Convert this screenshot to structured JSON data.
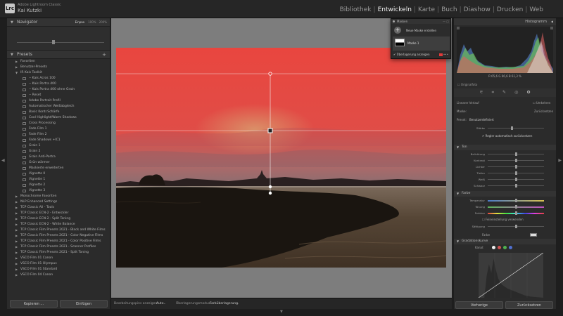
{
  "app": {
    "logo": "Lrc",
    "title": "Adobe Lightroom Classic",
    "user": "Kai Kutzki"
  },
  "modules": [
    "Bibliothek",
    "Entwickeln",
    "Karte",
    "Buch",
    "Diashow",
    "Drucken",
    "Web"
  ],
  "active_module": "Entwickeln",
  "navigator": {
    "title": "Navigator",
    "options": [
      "Einpas.",
      "100%",
      "200%"
    ],
    "active_option": "Einpas."
  },
  "presets": {
    "title": "Presets",
    "add_label": "+",
    "items": [
      {
        "label": "Favoriten",
        "level": 0,
        "kind": "group"
      },
      {
        "label": "Benutzer-Presets",
        "level": 0,
        "kind": "group"
      },
      {
        "label": "IR Kais Toolkit",
        "level": 0,
        "kind": "open"
      },
      {
        "label": "-- Kais Acros 100",
        "level": 1,
        "kind": "preset"
      },
      {
        "label": "-- Kais Portra 400",
        "level": 1,
        "kind": "preset"
      },
      {
        "label": "-- Kais Portra 400 ohne Grain",
        "level": 1,
        "kind": "preset"
      },
      {
        "label": "-- Reset",
        "level": 1,
        "kind": "preset"
      },
      {
        "label": "Adobe Portrait Profil",
        "level": 1,
        "kind": "preset"
      },
      {
        "label": "Automatischer Weißabgleich",
        "level": 1,
        "kind": "preset"
      },
      {
        "label": "Basic Kontr.Schärfe",
        "level": 1,
        "kind": "preset"
      },
      {
        "label": "Cool Highlight/Warm Shadows",
        "level": 1,
        "kind": "preset"
      },
      {
        "label": "Cross Processing",
        "level": 1,
        "kind": "preset"
      },
      {
        "label": "Fade Film 1",
        "level": 1,
        "kind": "preset"
      },
      {
        "label": "Fade Film 2",
        "level": 1,
        "kind": "preset"
      },
      {
        "label": "Fade Shadows +IC1",
        "level": 1,
        "kind": "preset"
      },
      {
        "label": "Grain 1",
        "level": 1,
        "kind": "preset"
      },
      {
        "label": "Grain 2",
        "level": 1,
        "kind": "preset"
      },
      {
        "label": "Grain Anti-Portra",
        "level": 1,
        "kind": "preset"
      },
      {
        "label": "Grün wärmer",
        "level": 1,
        "kind": "preset"
      },
      {
        "label": "Maskierte erweiterten",
        "level": 1,
        "kind": "preset"
      },
      {
        "label": "Vignette 0",
        "level": 1,
        "kind": "preset"
      },
      {
        "label": "Vignette 1",
        "level": 1,
        "kind": "preset"
      },
      {
        "label": "Vignette 2",
        "level": 1,
        "kind": "preset"
      },
      {
        "label": "Vignette 3",
        "level": 1,
        "kind": "preset"
      },
      {
        "label": "Monochrome Favoriten",
        "level": 0,
        "kind": "group"
      },
      {
        "label": "NLP Enhanced Settings",
        "level": 0,
        "kind": "group"
      },
      {
        "label": "TCP Classic All - Tools",
        "level": 0,
        "kind": "group"
      },
      {
        "label": "TCP Classic ECN-2 - Entwickler",
        "level": 0,
        "kind": "group"
      },
      {
        "label": "TCP Classic ECN-2 - Split Toning",
        "level": 0,
        "kind": "group"
      },
      {
        "label": "TCP Classic ECN-2 - White Balance",
        "level": 0,
        "kind": "group"
      },
      {
        "label": "TCP Classic Film Presets 2021 - Black and White Films",
        "level": 0,
        "kind": "group"
      },
      {
        "label": "TCP Classic Film Presets 2021 - Color Negative Films",
        "level": 0,
        "kind": "group"
      },
      {
        "label": "TCP Classic Film Presets 2021 - Color Positive Films",
        "level": 0,
        "kind": "group"
      },
      {
        "label": "TCP Classic Film Presets 2021 - Scanner Profiles",
        "level": 0,
        "kind": "group"
      },
      {
        "label": "TCP Classic Film Presets 2021 - Split Toning",
        "level": 0,
        "kind": "group"
      },
      {
        "label": "VSCO Film 01 Canon",
        "level": 0,
        "kind": "group"
      },
      {
        "label": "VSCO Film 01 Olympus",
        "level": 0,
        "kind": "group"
      },
      {
        "label": "VSCO Film 01 Standard",
        "level": 0,
        "kind": "group"
      },
      {
        "label": "VSCO Film 04 Canon",
        "level": 0,
        "kind": "group"
      }
    ]
  },
  "left_buttons": {
    "import": "Kopieren ...",
    "paste": "Einfügen"
  },
  "toolbar": {
    "show_edit_pins_label": "Bearbeitungspins anzeigen:",
    "show_edit_pins_value": "Auto",
    "overlay_mode_label": "Überlagerungsmodus:",
    "overlay_mode_value": "Farbüberlagerung"
  },
  "masks": {
    "title": "Masken",
    "new_mask": "Neue Maske erstellen",
    "mask_name": "Maske 1",
    "show_overlay": "Überlagerung anzeigen"
  },
  "histogram": {
    "title": "Histogramm",
    "values_line": "R  65,6   G  66,6   B  61,3   %",
    "original_photo": "Originalfoto"
  },
  "right": {
    "gradient_label": "Linearer Verlauf",
    "invert_label": "Umkehren",
    "mask_label": "Maske:",
    "mask_settings": "Zurücksetzen",
    "preset_label": "Preset:",
    "preset_value": "Benutzerdefiniert",
    "amount_label": "Stärke",
    "auto_reset": "Regler automatisch zurücksetzen",
    "section_tone": "Ton",
    "section_color": "Farbe",
    "section_curve": "Gradationskurve",
    "tone_sliders": [
      "Belichtung",
      "Kontrast",
      "Lichter",
      "Tiefen",
      "Weiß",
      "Schwarz"
    ],
    "color_sliders": [
      "Temperatur",
      "Tönung",
      "Farbton"
    ],
    "use_fine_adjust": "Feineinstellung verwenden",
    "saturation_label": "Sättigung",
    "color_label": "Farbe",
    "curve_channel": "Kanal:",
    "prev_button": "Vorherige",
    "reset_button": "Zurücksetzen"
  },
  "colors": {
    "overlay_red": "#e0413f",
    "accent": "#e8e8e8"
  }
}
